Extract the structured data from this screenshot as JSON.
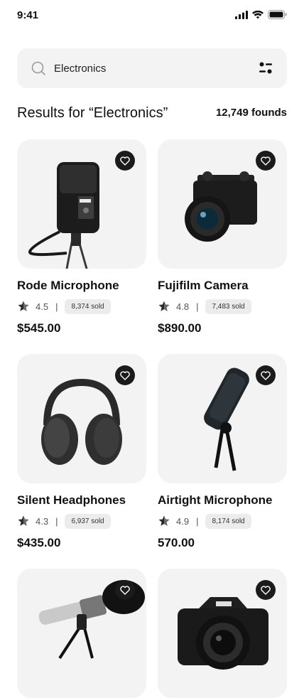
{
  "status": {
    "time": "9:41"
  },
  "search": {
    "value": "Electronics"
  },
  "results": {
    "title": "Results for “Electronics”",
    "count": "12,749 founds"
  },
  "products": [
    {
      "name": "Rode Microphone",
      "rating": "4.5",
      "sold": "8,374 sold",
      "price": "$545.00"
    },
    {
      "name": "Fujifilm Camera",
      "rating": "4.8",
      "sold": "7,483 sold",
      "price": "$890.00"
    },
    {
      "name": "Silent Headphones",
      "rating": "4.3",
      "sold": "6,937 sold",
      "price": "$435.00"
    },
    {
      "name": "Airtight Microphone",
      "rating": "4.9",
      "sold": "8,174 sold",
      "price": "570.00"
    },
    {
      "name": "",
      "rating": "",
      "sold": "",
      "price": ""
    },
    {
      "name": "",
      "rating": "",
      "sold": "",
      "price": ""
    }
  ],
  "colors": {
    "accent": "#1b1b1b",
    "surface": "#f3f3f3",
    "chip": "#ececec"
  },
  "icons": {
    "search": "search-icon",
    "filter": "filter-icon",
    "favorite": "heart-icon",
    "rating": "star-icon"
  }
}
